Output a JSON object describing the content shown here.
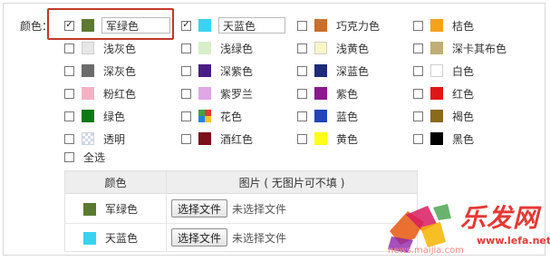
{
  "field_label": "颜色：",
  "select_all_label": "全选",
  "colors": [
    {
      "name": "军绿色",
      "color": "#5b7a2f",
      "checked": true,
      "editable": true
    },
    {
      "name": "天蓝色",
      "color": "#3ad3ef",
      "checked": true,
      "editable": true
    },
    {
      "name": "巧克力色",
      "color": "#c8702c",
      "checked": false
    },
    {
      "name": "桔色",
      "color": "#f5a21b",
      "checked": false
    },
    {
      "name": "浅灰色",
      "color": "#e6e6e6",
      "checked": false
    },
    {
      "name": "浅绿色",
      "color": "#d7efc9",
      "checked": false
    },
    {
      "name": "浅黄色",
      "color": "#fbf6c6",
      "checked": false
    },
    {
      "name": "深卡其布色",
      "color": "#c0ae76",
      "checked": false
    },
    {
      "name": "深灰色",
      "color": "#6b6b6b",
      "checked": false
    },
    {
      "name": "深紫色",
      "color": "#4a1e84",
      "checked": false
    },
    {
      "name": "深蓝色",
      "color": "#1f2a7a",
      "checked": false
    },
    {
      "name": "白色",
      "color": "#ffffff",
      "checked": false
    },
    {
      "name": "粉红色",
      "color": "#f5b1c3",
      "checked": false
    },
    {
      "name": "紫罗兰",
      "color": "#e0a6e6",
      "checked": false
    },
    {
      "name": "紫色",
      "color": "#8a1a8e",
      "checked": false
    },
    {
      "name": "红色",
      "color": "#e01616",
      "checked": false
    },
    {
      "name": "绿色",
      "color": "#0b7a12",
      "checked": false
    },
    {
      "name": "花色",
      "color": "multi",
      "checked": false
    },
    {
      "name": "蓝色",
      "color": "#2244b8",
      "checked": false
    },
    {
      "name": "褐色",
      "color": "#8a6a1a",
      "checked": false
    },
    {
      "name": "透明",
      "color": "transparent",
      "checked": false
    },
    {
      "name": "酒红色",
      "color": "#7d0f18",
      "checked": false
    },
    {
      "name": "黄色",
      "color": "#ffff18",
      "checked": false
    },
    {
      "name": "黑色",
      "color": "#000000",
      "checked": false
    }
  ],
  "table": {
    "headers": [
      "颜色",
      "图片 ( 无图片可不填 )"
    ],
    "rows": [
      {
        "color_name": "军绿色",
        "color": "#5b7a2f",
        "button": "选择文件",
        "status": "未选择文件"
      },
      {
        "color_name": "天蓝色",
        "color": "#3ad3ef",
        "button": "选择文件",
        "status": "未选择文件"
      }
    ]
  },
  "watermark": {
    "title": "乐发网",
    "line1": "www.lefa.net",
    "line2": "news.maijia.com"
  }
}
